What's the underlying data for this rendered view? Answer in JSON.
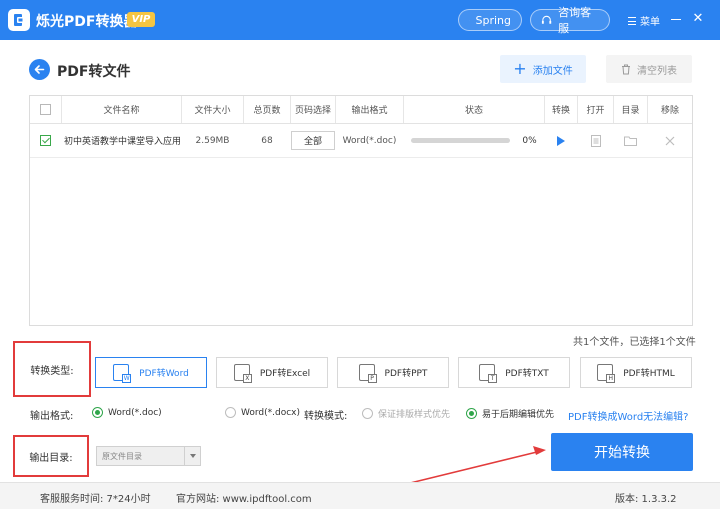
{
  "titlebar": {
    "app_name": "烁光PDF转换器",
    "vip_badge": "VIP",
    "user_name": "Spring",
    "service_label": "咨询客服",
    "menu_label": "菜单",
    "close_symbol": "✕"
  },
  "header": {
    "title": "PDF转文件",
    "add_file_label": "添加文件",
    "clear_list_label": "清空列表"
  },
  "table": {
    "columns": [
      "文件名称",
      "文件大小",
      "总页数",
      "页码选择",
      "输出格式",
      "状态",
      "转换",
      "打开",
      "目录",
      "移除"
    ],
    "rows": [
      {
        "checked": true,
        "name": "初中英语教学中课堂导入应用...",
        "size": "2.59MB",
        "pages": "68",
        "range": "全部",
        "format": "Word(*.doc)",
        "progress": 0,
        "progress_text": "0%"
      }
    ]
  },
  "file_count": "共1个文件，已选择1个文件",
  "conversion": {
    "label": "转换类型:",
    "types": [
      {
        "label": "PDF转Word",
        "icon": "W",
        "active": true
      },
      {
        "label": "PDF转Excel",
        "icon": "X",
        "active": false
      },
      {
        "label": "PDF转PPT",
        "icon": "P",
        "active": false
      },
      {
        "label": "PDF转TXT",
        "icon": "T",
        "active": false
      },
      {
        "label": "PDF转HTML",
        "icon": "H",
        "active": false
      }
    ]
  },
  "output_format": {
    "label": "输出格式:",
    "option_doc": "Word(*.doc)",
    "option_docx": "Word(*.docx)",
    "mode_label": "转换模式:",
    "mode_layout": "保证排版样式优先",
    "mode_edit": "易于后期编辑优先",
    "help_link": "PDF转换成Word无法编辑?"
  },
  "output_dir": {
    "label": "输出目录:",
    "value": "原文件目录"
  },
  "start_button": "开始转换",
  "footer": {
    "hours": "客服服务时间:  7*24小时",
    "site": "官方网站:  www.ipdftool.com",
    "version": "版本:  1.3.3.2"
  },
  "colors": {
    "primary": "#2a82f0",
    "highlight": "#e23b3b",
    "check": "#3aa84a"
  }
}
